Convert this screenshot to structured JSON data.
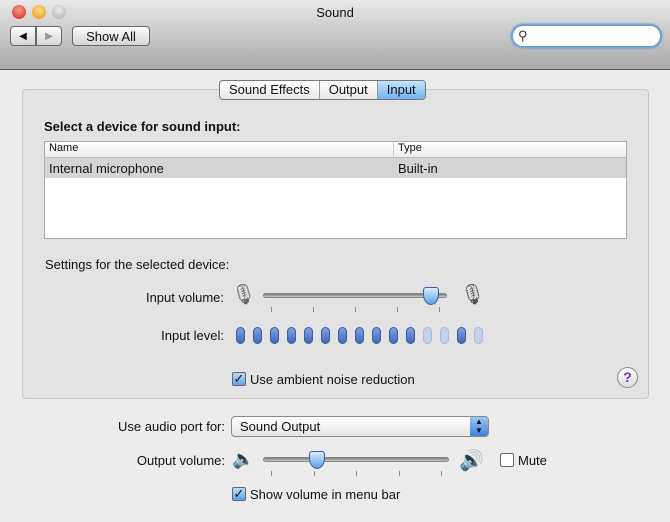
{
  "window": {
    "title": "Sound"
  },
  "toolbar": {
    "back": "◀",
    "forward": "▶",
    "show_all": "Show All",
    "search_placeholder": ""
  },
  "tabs": [
    {
      "label": "Sound Effects",
      "selected": false
    },
    {
      "label": "Output",
      "selected": false
    },
    {
      "label": "Input",
      "selected": true
    }
  ],
  "input": {
    "heading": "Select a device for sound input:",
    "columns": [
      "Name",
      "Type"
    ],
    "rows": [
      {
        "name": "Internal microphone",
        "type": "Built-in",
        "selected": true
      }
    ],
    "settings_label": "Settings for the selected device:",
    "input_volume_label": "Input volume:",
    "input_volume_percent": 95,
    "input_level_label": "Input level:",
    "input_level_pips": [
      1,
      1,
      1,
      1,
      1,
      1,
      1,
      1,
      1,
      1,
      1,
      0,
      0,
      1,
      0
    ],
    "noise_reduction_label": "Use ambient noise reduction",
    "noise_reduction_checked": true,
    "help": "?"
  },
  "bottom": {
    "audio_port_label": "Use audio port for:",
    "audio_port_value": "Sound Output",
    "output_volume_label": "Output volume:",
    "output_volume_percent": 27,
    "mute_label": "Mute",
    "mute_checked": false,
    "show_volume_label": "Show volume in menu bar",
    "show_volume_checked": true
  },
  "colors": {
    "accent": "#5aa0e8",
    "close": "#e0443a",
    "minimize": "#f0a522"
  }
}
